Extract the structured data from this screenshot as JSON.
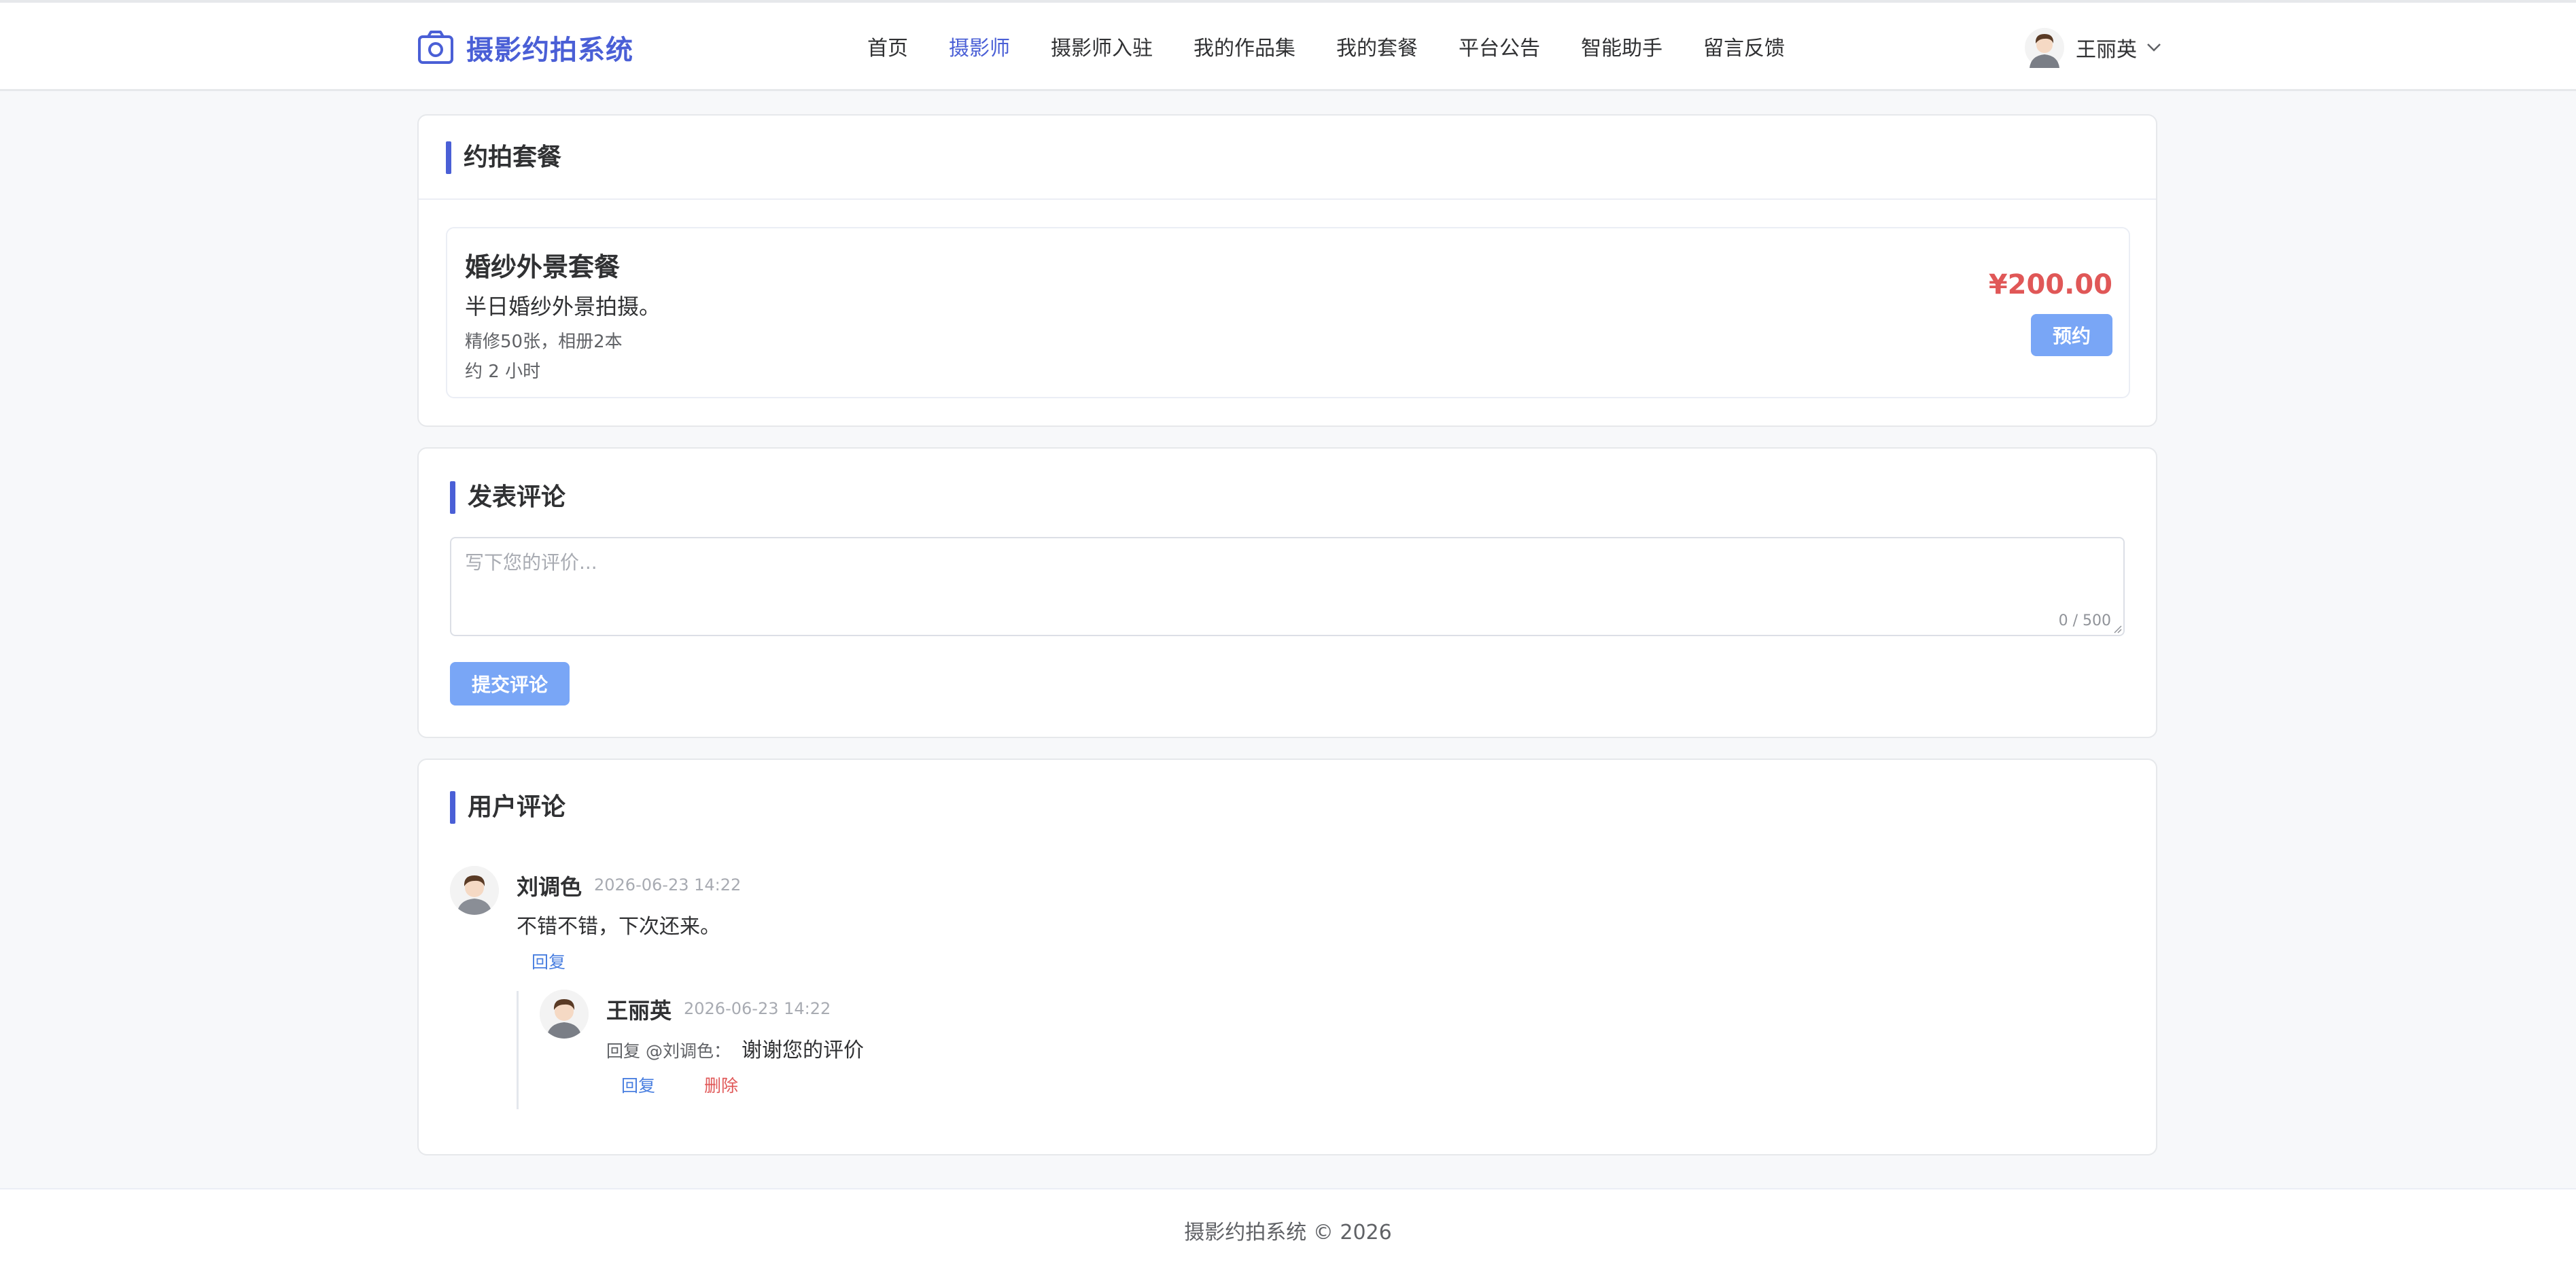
{
  "header": {
    "app_title": "摄影约拍系统",
    "nav": [
      {
        "label": "首页",
        "active": false
      },
      {
        "label": "摄影师",
        "active": true
      },
      {
        "label": "摄影师入驻",
        "active": false
      },
      {
        "label": "我的作品集",
        "active": false
      },
      {
        "label": "我的套餐",
        "active": false
      },
      {
        "label": "平台公告",
        "active": false
      },
      {
        "label": "智能助手",
        "active": false
      },
      {
        "label": "留言反馈",
        "active": false
      }
    ],
    "user_name": "王丽英"
  },
  "packages": {
    "section_title": "约拍套餐",
    "items": [
      {
        "name": "婚纱外景套餐",
        "description": "半日婚纱外景拍摄。",
        "detail": "精修50张，相册2本",
        "duration": "约 2 小时",
        "price": "¥200.00",
        "book_label": "预约"
      }
    ]
  },
  "comment_form": {
    "section_title": "发表评论",
    "placeholder": "写下您的评价...",
    "counter": "0 / 500",
    "submit_label": "提交评论"
  },
  "comments": {
    "section_title": "用户评论",
    "items": [
      {
        "author": "刘调色",
        "time": "2026-06-23 14:22",
        "text": "不错不错，下次还来。",
        "reply_label": "回复",
        "replies": [
          {
            "author": "王丽英",
            "time": "2026-06-23 14:22",
            "reply_prefix": "回复 @刘调色：",
            "text": "谢谢您的评价",
            "reply_label": "回复",
            "delete_label": "删除"
          }
        ]
      }
    ]
  },
  "footer": {
    "text": "摄影约拍系统 © 2026"
  },
  "colors": {
    "brand": "#4a5fd6",
    "button": "#79a6f6",
    "price": "#e05757",
    "link": "#4a7fe0"
  }
}
